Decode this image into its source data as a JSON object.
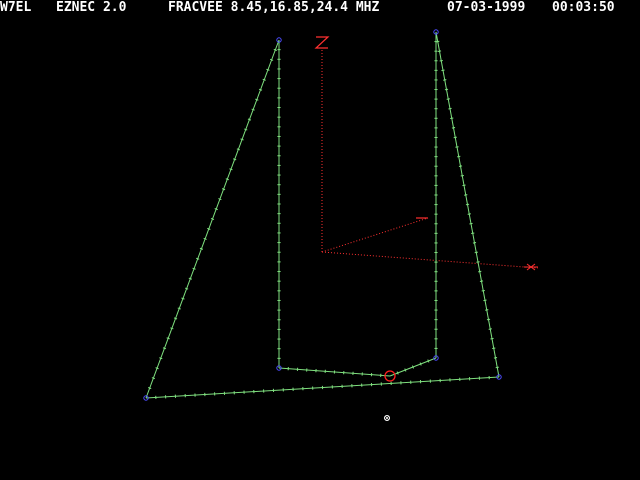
{
  "status": {
    "callsign": "W7EL",
    "program": "EZNEC 2.0",
    "frequency": "FRACVEE 8.45,16.85,24.4 MHZ",
    "date": "07-03-1999",
    "time": "00:03:50"
  },
  "colors": {
    "background": "#000000",
    "text": "#ffffff",
    "wire": "#7fe07f",
    "segment_mark": "#7fe07f",
    "wire_end": "#4d4dff",
    "axis": "#ff3030",
    "source": "#ff2020",
    "ground_marker": "#ffffff"
  },
  "icons": {
    "source": "source-circle-icon",
    "wire_end": "wire-end-circle-icon",
    "ground_marker": "ground-marker-icon"
  }
}
